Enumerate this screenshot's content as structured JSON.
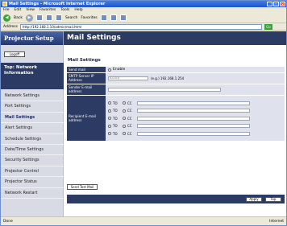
{
  "window": {
    "title": "Mail Settings - Microsoft Internet Explorer",
    "controls": [
      "_",
      "□",
      "×"
    ]
  },
  "menubar": [
    "File",
    "Edit",
    "View",
    "Favorites",
    "Tools",
    "Help"
  ],
  "toolbar": {
    "back_label": "Back",
    "search_label": "Search",
    "favorites_label": "Favorites"
  },
  "addressbar": {
    "label": "Address",
    "url": "http://192.168.1.10/admin/mail.html",
    "go_label": "Go"
  },
  "brand": {
    "name": "Projector Setup",
    "page_title": "Mail Settings"
  },
  "sidebar": {
    "logoff": "Logoff",
    "top_label": "Top: Network Information",
    "items": [
      {
        "label": "Network Settings"
      },
      {
        "label": "Port Settings"
      },
      {
        "label": "Mail Settings"
      },
      {
        "label": "Alert Settings"
      },
      {
        "label": "Schedule Settings"
      },
      {
        "label": "Date/Time Settings"
      },
      {
        "label": "Security Settings"
      },
      {
        "label": "Projector Control"
      },
      {
        "label": "Projector Status"
      },
      {
        "label": "Network Restart"
      }
    ]
  },
  "form": {
    "section_title": "Mail Settings",
    "send_mail_label": "Send mail",
    "send_mail_option": "Enable",
    "smtp_label": "SMTP Server IP Address",
    "smtp_value": "0.0.0.0",
    "smtp_hint": "(e.g.) 192.168.1.254",
    "sender_label": "Sender E-mail address",
    "recipient_label": "Recipient E-mail address",
    "to_label": "TO",
    "cc_label": "CC",
    "recipient_count": 5,
    "send_test_label": "Send Test Mail",
    "apply_label": "Apply",
    "top_label": "Top"
  },
  "statusbar": {
    "left": "Done",
    "right": "Internet"
  }
}
